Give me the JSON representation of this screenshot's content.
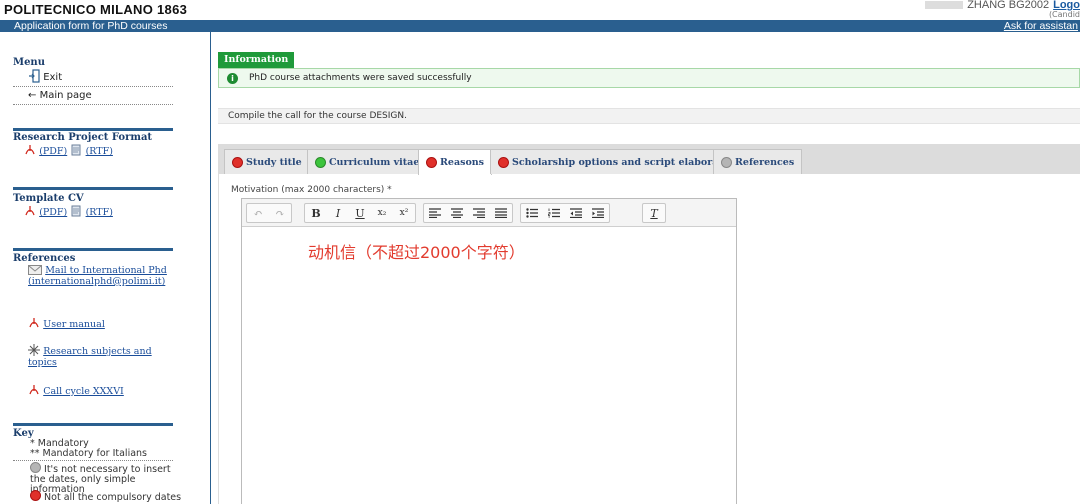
{
  "header": {
    "brand": "POLITECNICO MILANO 1863",
    "user": "ZHANG BG2002",
    "logout": "Logo",
    "candidate_note": "(Candid",
    "app_title": "Application form for PhD courses",
    "assistance": "Ask for assistan"
  },
  "sidebar": {
    "menu_title": "Menu",
    "exit": "Exit",
    "main_page": "Main page",
    "research_title": "Research Project Format",
    "template_title": "Template CV",
    "pdf": "(PDF)",
    "rtf": "(RTF)",
    "references_title": "References",
    "ref_mail": "Mail to International Phd (internationalphd@polimi.it)",
    "ref_manual": "User manual",
    "ref_subjects": "Research subjects and topics",
    "ref_call": "Call cycle XXXVI",
    "key_title": "Key",
    "key_mandatory": "* Mandatory",
    "key_mandatory_it": "** Mandatory for Italians",
    "key_grey": "It's not necessary to insert the dates, only simple information",
    "key_red": "Not all the compulsory dates"
  },
  "info": {
    "tab": "Information",
    "message": "PhD course attachments were saved successfully"
  },
  "call_text": "Compile the call for the course DESIGN.",
  "tabs": [
    {
      "label": "Study title",
      "status": "red"
    },
    {
      "label": "Curriculum vitae",
      "status": "green"
    },
    {
      "label": "Reasons",
      "status": "red"
    },
    {
      "label": "Scholarship options and script elaborate",
      "status": "red"
    },
    {
      "label": "References",
      "status": "grey"
    }
  ],
  "editor": {
    "label": "Motivation (max 2000 characters) *",
    "content": "动机信（不超过2000个字符）"
  },
  "colors": {
    "brand_blue": "#2a5f8f",
    "status_red": "#e0302a",
    "status_green": "#3cc43c",
    "status_grey": "#b5b5b5",
    "info_green": "#1f9a3a"
  }
}
